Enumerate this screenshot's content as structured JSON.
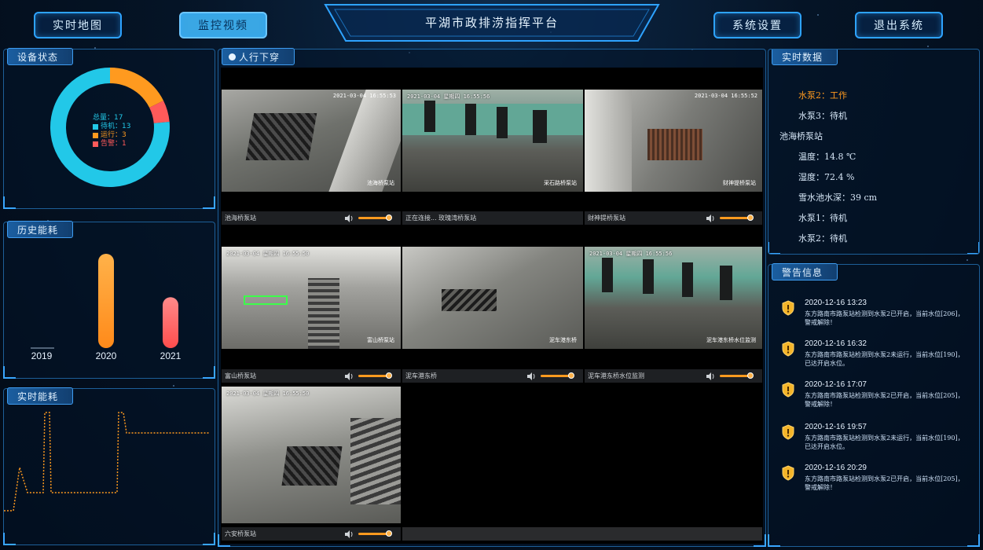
{
  "header": {
    "title": "平湖市政排涝指挥平台",
    "buttons": {
      "realtime_map": "实时地图",
      "monitor_video": "监控视频",
      "system_settings": "系统设置",
      "logout": "退出系统"
    }
  },
  "device_status": {
    "tab": "设备状态",
    "total": "总量：17",
    "legend": [
      {
        "label": "待机：13",
        "color": "#22c8e8"
      },
      {
        "label": "运行：3",
        "color": "#ff9a1f"
      },
      {
        "label": "告警：1",
        "color": "#ff5a5a"
      }
    ],
    "values": {
      "standby": 13,
      "running": 3,
      "alarm": 1
    }
  },
  "history_energy": {
    "tab": "历史能耗",
    "chart_data": {
      "type": "bar",
      "categories": [
        "2019",
        "2020",
        "2021"
      ],
      "values": [
        0,
        100,
        54
      ]
    }
  },
  "realtime_energy": {
    "tab": "实时能耗"
  },
  "video": {
    "tab": "人行下穿",
    "cameras": [
      {
        "ts": "2021-03-04 16:55:53",
        "name": "池海桥泵站",
        "overlay": "池海桥泵站"
      },
      {
        "ts": "2021-03-04  星期四 16:55:56",
        "name": "正在连接...  玫瑰湾桥泵站",
        "overlay": "采石路桥泵站"
      },
      {
        "ts": "2021-03-04  16:55:52",
        "name": "财神提桥泵站",
        "overlay": "财神提桥泵站"
      },
      {
        "ts": "2021-03-04  星期四 16:55:50",
        "name": "富山桥泵站",
        "overlay": "富山桥泵站"
      },
      {
        "ts": "",
        "name": "泥车港东桥",
        "overlay": "泥车港东桥"
      },
      {
        "ts": "2021-03-04  星期四 16:55:56",
        "name": "泥车港东桥水位监测",
        "overlay": "泥车港东桥水位监测"
      },
      {
        "ts": "2021-03-04  星期四 16:55:50",
        "name": "六安桥泵站",
        "overlay": ""
      }
    ]
  },
  "realtime_data": {
    "tab": "实时数据",
    "rows": [
      {
        "text": "水泵2：工作",
        "color": "#ff9a1f"
      },
      {
        "text": "水泵3：待机",
        "color": "#d8e8f8"
      },
      {
        "text": "池海桥泵站",
        "color": "#d8e8f8"
      },
      {
        "text": "温度：14.8 ℃",
        "color": "#d8e8f8"
      },
      {
        "text": "湿度：72.4 %",
        "color": "#d8e8f8"
      },
      {
        "text": "雪水池水深：39 cm",
        "color": "#d8e8f8"
      },
      {
        "text": "水泵1：待机",
        "color": "#d8e8f8"
      },
      {
        "text": "水泵2：待机",
        "color": "#d8e8f8"
      }
    ]
  },
  "alerts": {
    "tab": "警告信息",
    "items": [
      {
        "time": "2020-12-16 13:23",
        "msg": "东方路南市路泵站检测到水泵2已开启，当前水位[206]，警戒解除！"
      },
      {
        "time": "2020-12-16 16:32",
        "msg": "东方路南市路泵站检测到水泵2未运行，当前水位[190]，已达开启水位。"
      },
      {
        "time": "2020-12-16 17:07",
        "msg": "东方路南市路泵站检测到水泵2已开启，当前水位[205]，警戒解除！"
      },
      {
        "time": "2020-12-16 19:57",
        "msg": "东方路南市路泵站检测到水泵2未运行，当前水位[190]，已达开启水位。"
      },
      {
        "time": "2020-12-16 20:29",
        "msg": "东方路南市路泵站检测到水泵2已开启，当前水位[205]，警戒解除！"
      }
    ]
  }
}
